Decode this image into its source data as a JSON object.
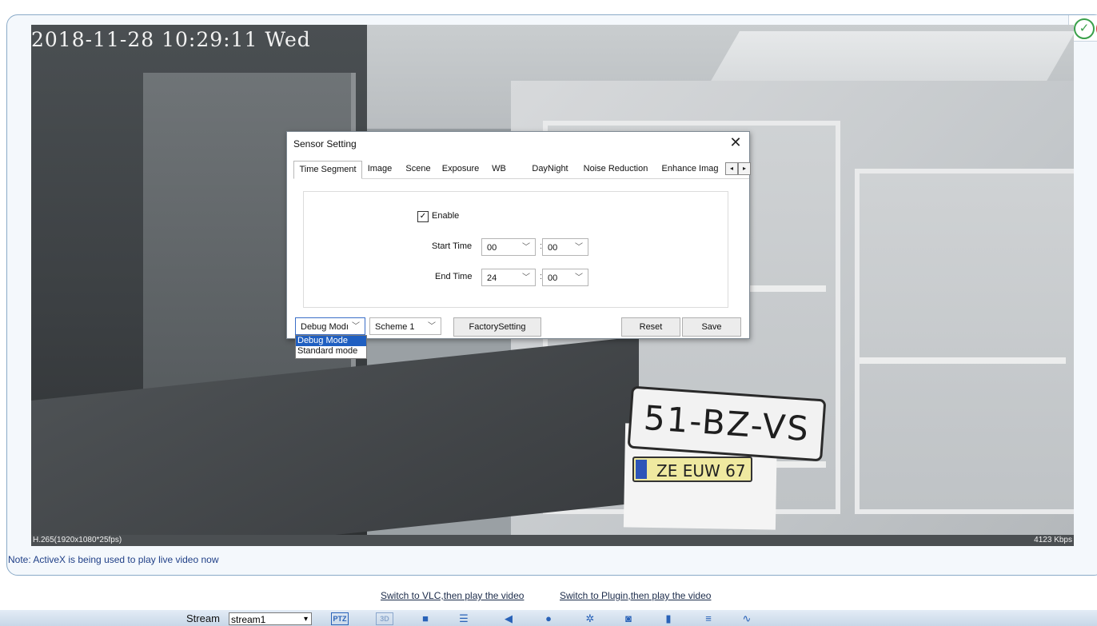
{
  "video": {
    "timestamp": "2018-11-28 10:29:11 Wed",
    "codec_info": "H.265(1920x1080*25fps)",
    "bitrate": "4123 Kbps",
    "plate_large": "51-BZ-VS",
    "plate_small": "ZE EUW 67"
  },
  "note": "Note: ActiveX is being used to play live video now",
  "dialog": {
    "title": "Sensor Setting",
    "close_icon": "close-icon",
    "tabs": [
      "Time Segment",
      "Image",
      "Scene",
      "Exposure",
      "WB",
      "DayNight",
      "Noise Reduction",
      "Enhance Imag"
    ],
    "active_tab": "Time Segment",
    "enable_label": "Enable",
    "enable_checked": true,
    "start_time_label": "Start Time",
    "start_hour": "00",
    "start_minute": "00",
    "end_time_label": "End Time",
    "end_hour": "24",
    "end_minute": "00",
    "colon": ":",
    "mode_select": "Debug Modı",
    "scheme_select": "Scheme 1",
    "factory_button": "FactorySetting",
    "reset_button": "Reset",
    "save_button": "Save",
    "mode_options": [
      "Debug Mode",
      "Standard mode"
    ],
    "mode_selected": "Debug Mode"
  },
  "links": {
    "vlc": "Switch to VLC,then play the video",
    "plugin": "Switch to Plugin,then play the video"
  },
  "toolbar": {
    "stream_label": "Stream",
    "stream_value": "stream1",
    "ptz": "PTZ",
    "threed": "3D",
    "icons": [
      "stop-icon",
      "record-list-icon",
      "speaker-icon",
      "microphone-icon",
      "settings-icon",
      "snapshot-icon",
      "video-record-icon",
      "list-icon",
      "waveform-icon"
    ]
  },
  "colors": {
    "accent": "#2962b8",
    "note_text": "#1f3f87",
    "dropdown_selected": "#1f5fc1"
  }
}
